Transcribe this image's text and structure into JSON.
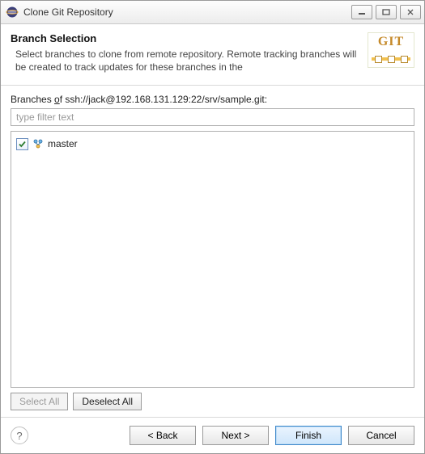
{
  "window": {
    "title": "Clone Git Repository"
  },
  "banner": {
    "heading": "Branch Selection",
    "description": "Select branches to clone from remote repository. Remote tracking branches will be created to track updates for these branches in the",
    "badge_text": "GIT"
  },
  "content": {
    "branches_label_prefix": "Branches ",
    "branches_label_underlined": "o",
    "branches_label_suffix": "f ssh://jack@192.168.131.129:22/srv/sample.git:",
    "filter_placeholder": "type filter text",
    "items": [
      {
        "label": "master",
        "checked": true
      }
    ],
    "select_all": "Select All",
    "deselect_all": "Deselect All"
  },
  "footer": {
    "back": "< Back",
    "next": "Next >",
    "finish": "Finish",
    "cancel": "Cancel"
  }
}
